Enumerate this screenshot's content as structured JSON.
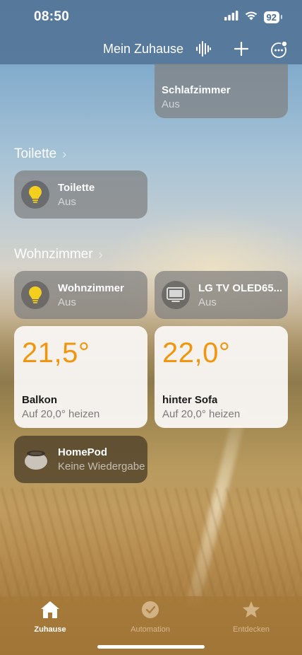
{
  "status_bar": {
    "time": "08:50",
    "battery": "92"
  },
  "nav": {
    "title": "Mein Zuhause"
  },
  "top_partial_tile": {
    "name": "Schlafzimmer",
    "status": "Aus"
  },
  "sections": [
    {
      "title": "Toilette",
      "tiles": [
        {
          "name": "Toilette",
          "status": "Aus",
          "icon": "lightbulb-icon"
        }
      ]
    },
    {
      "title": "Wohnzimmer",
      "tiles": [
        {
          "name": "Wohnzimmer",
          "status": "Aus",
          "icon": "lightbulb-icon"
        },
        {
          "name": "LG TV OLED65...",
          "status": "Aus",
          "icon": "tv-icon"
        },
        {
          "name": "Balkon",
          "status": "Auf 20,0° heizen",
          "temperature": "21,5°"
        },
        {
          "name": "hinter Sofa",
          "status": "Auf 20,0° heizen",
          "temperature": "22,0°"
        },
        {
          "name": "HomePod",
          "status": "Keine Wiedergabe",
          "icon": "homepod-icon"
        }
      ]
    }
  ],
  "tabs": [
    {
      "label": "Zuhause",
      "icon": "house-icon",
      "active": true
    },
    {
      "label": "Automation",
      "icon": "clock-icon",
      "active": false
    },
    {
      "label": "Entdecken",
      "icon": "star-icon",
      "active": false
    }
  ],
  "colors": {
    "temperature": "#f0950c",
    "bulb": "#f5cf1e",
    "nav_bar": "#52749a"
  }
}
